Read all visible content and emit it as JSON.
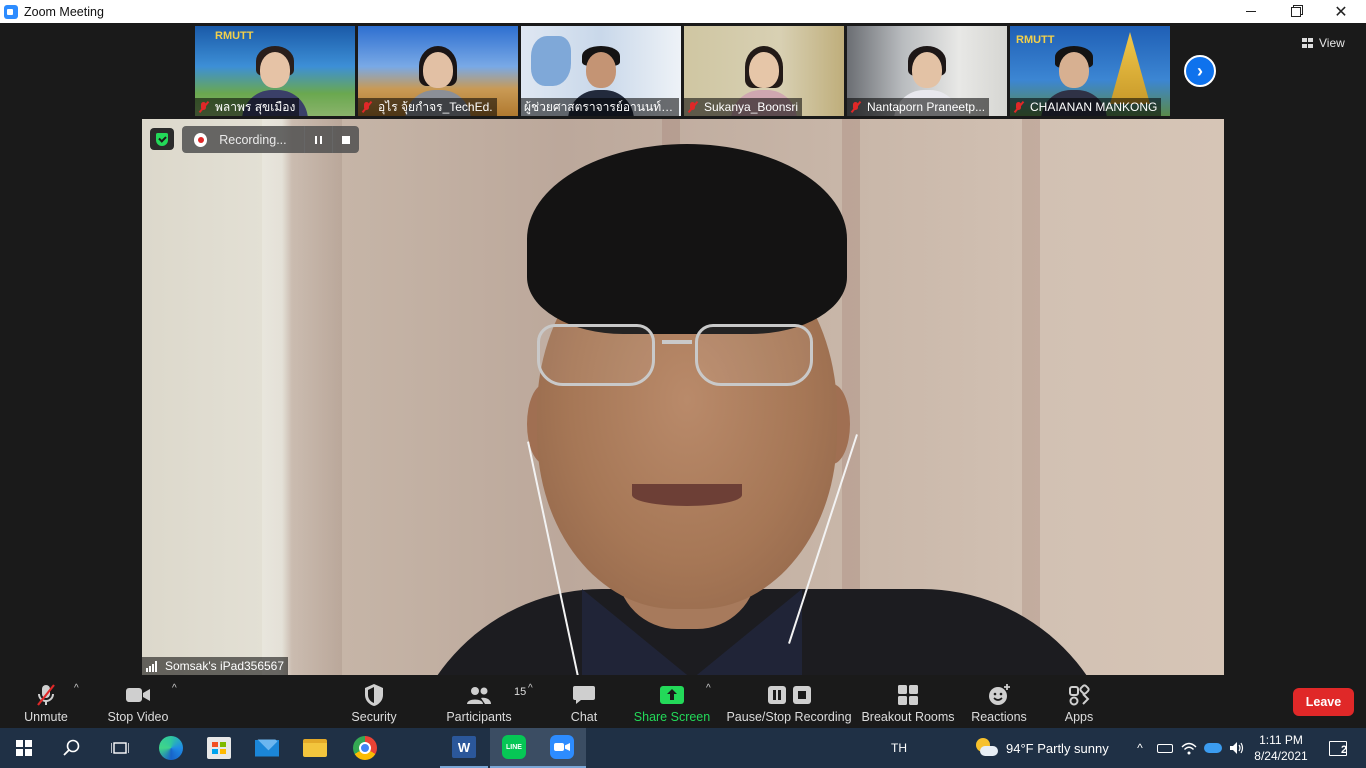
{
  "window": {
    "title": "Zoom Meeting"
  },
  "gallery": {
    "participants": [
      {
        "name": "พลาพร สุขเมือง",
        "muted": true
      },
      {
        "name": "อุไร จุ้ยกำจร_TechEd.",
        "muted": true
      },
      {
        "name": "ผู้ช่วยศาสตราจารย์อานนท์ วิ...",
        "muted": false
      },
      {
        "name": "Sukanya_Boonsri",
        "muted": true
      },
      {
        "name": "Nantaporn Praneetp...",
        "muted": true
      },
      {
        "name": "CHAIANAN MANKONG",
        "muted": true
      }
    ],
    "view_label": "View"
  },
  "active_speaker": {
    "name": "Somsak's iPad356567",
    "recording_label": "Recording..."
  },
  "toolbar": {
    "unmute": "Unmute",
    "stop_video": "Stop Video",
    "security": "Security",
    "participants": "Participants",
    "participant_count": "15",
    "chat": "Chat",
    "share_screen": "Share Screen",
    "pause_stop_recording": "Pause/Stop Recording",
    "breakout_rooms": "Breakout Rooms",
    "reactions": "Reactions",
    "apps": "Apps",
    "leave": "Leave"
  },
  "taskbar": {
    "language": "TH",
    "weather": "94°F  Partly sunny",
    "time": "1:11 PM",
    "date": "8/24/2021",
    "notification_count": "2"
  },
  "colors": {
    "zoom_blue": "#2D8CFF",
    "leave_red": "#E02828",
    "share_green": "#23D959",
    "toolbar_bg": "#1A1A1A",
    "taskbar_bg": "#1F3045"
  }
}
